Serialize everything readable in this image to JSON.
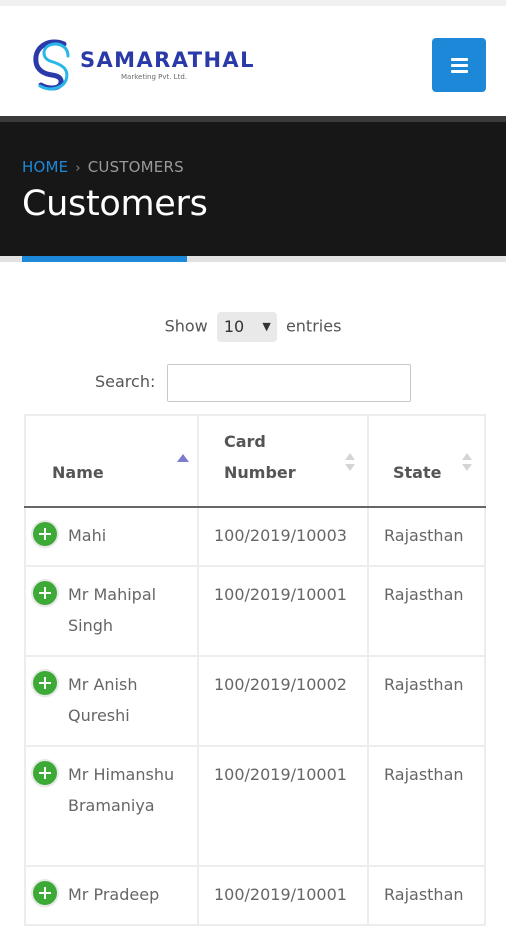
{
  "logo": {
    "name": "SAMARATHAL",
    "subtitle": "Marketing Pvt. Ltd."
  },
  "header": {
    "menu_icon": "hamburger-icon",
    "accent_color": "#1e88d8"
  },
  "breadcrumb": {
    "home": "HOME",
    "separator": "›",
    "current": "CUSTOMERS"
  },
  "page_title": "Customers",
  "table_controls": {
    "show_label": "Show",
    "entries_value": "10",
    "entries_label": "entries",
    "search_label": "Search:",
    "search_value": ""
  },
  "table": {
    "columns": [
      "Name",
      "Card Number",
      "State"
    ],
    "sorted_column": "Name",
    "sort_direction": "ascending",
    "rows": [
      {
        "name": "Mahi",
        "card": "100/2019/10003",
        "state": "Rajasthan"
      },
      {
        "name": "Mr Mahipal Singh",
        "card": "100/2019/10001",
        "state": "Rajasthan"
      },
      {
        "name": "Mr Anish Qureshi",
        "card": "100/2019/10002",
        "state": "Rajasthan"
      },
      {
        "name": "Mr Himanshu Bramaniya",
        "card": "100/2019/10001",
        "state": "Rajasthan"
      },
      {
        "name": "Mr Pradeep",
        "card": "100/2019/10001",
        "state": "Rajasthan"
      }
    ]
  },
  "colors": {
    "banner": "#171717",
    "expand_button": "#3daa37",
    "logo_blue": "#2a3aa8"
  }
}
